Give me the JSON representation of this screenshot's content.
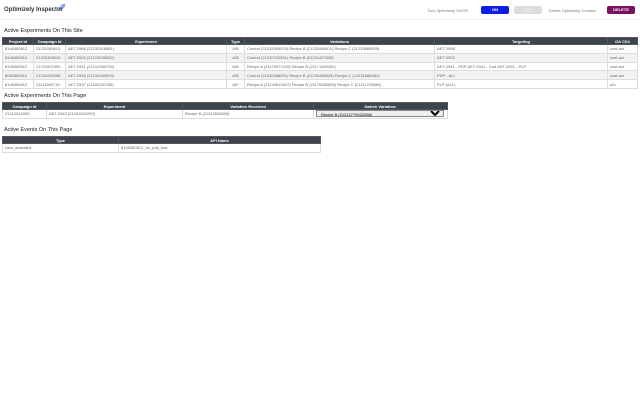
{
  "header": {
    "title": "Optimizely Inspector",
    "toggle_label": "Turn Optimizely On/Off",
    "on_label": "ON",
    "off_label": "OFF",
    "delete_label": "Delete Optimizely Cookies",
    "delete_button": "DELETE"
  },
  "site": {
    "title": "Active Experiments On This Site",
    "headers": [
      "Project Id",
      "Campaign Id",
      "Experiment",
      "Type",
      "Variations",
      "Targeting",
      "GA CD#"
    ],
    "rows": [
      [
        "8146080612",
        "21231190613",
        "AET-2966 (21232518881)",
        "A/B",
        "Control (21232060020) Recipe B (21232488411) Recipe C (21233885505)",
        "AET-2958",
        "cust-act"
      ],
      [
        "8146080612",
        "21230399045",
        "AET-2903 (21223036052)",
        "A/B",
        "Control (21230732951) Recipe B (21231423308)",
        "AET-2903",
        "cust-act"
      ],
      [
        "8146080612",
        "21231522309",
        "AET-2941 (21212260734)",
        "A/B",
        "Recipe A (21179972129) Recipe B (21171169281)",
        "AET-2941 - PDP AET-2941 - Cart AET-2941 - PLP",
        "cust-act"
      ],
      [
        "8082680612",
        "21231000088",
        "AET-2946 (21230483009)",
        "A/B",
        "Control (21230468051) Recipe B (21230468026) Recipe C (21231880484)",
        "PDP - ALL",
        "cust-act"
      ],
      [
        "8146080612",
        "21111000719",
        "AET-2937 (21182100785)",
        "A/F",
        "Recipe A (21144810047) Recipe B (21170580655) Recipe C (21111700088)",
        "PLP (ALL)",
        "ufo"
      ]
    ]
  },
  "page": {
    "title": "Active Experiments On This Page",
    "headers": [
      "Campaign Id",
      "Experiment",
      "Variation Received",
      "Switch Variation:"
    ],
    "rows": [
      [
        "21212610289",
        "AET-2942 (21202620293)",
        "Recipe B (21212608300)",
        "Recipe B (21212779022086)"
      ]
    ]
  },
  "events": {
    "title": "Active Events On This Page",
    "headers": [
      "Type",
      "API Name"
    ],
    "rows": [
      [
        "view_activated",
        "8146080612_trk_pdp_test"
      ]
    ]
  },
  "colors": {
    "on": "#0b1fe6",
    "delete": "#7a1060",
    "header_bg": "#3d4450"
  }
}
